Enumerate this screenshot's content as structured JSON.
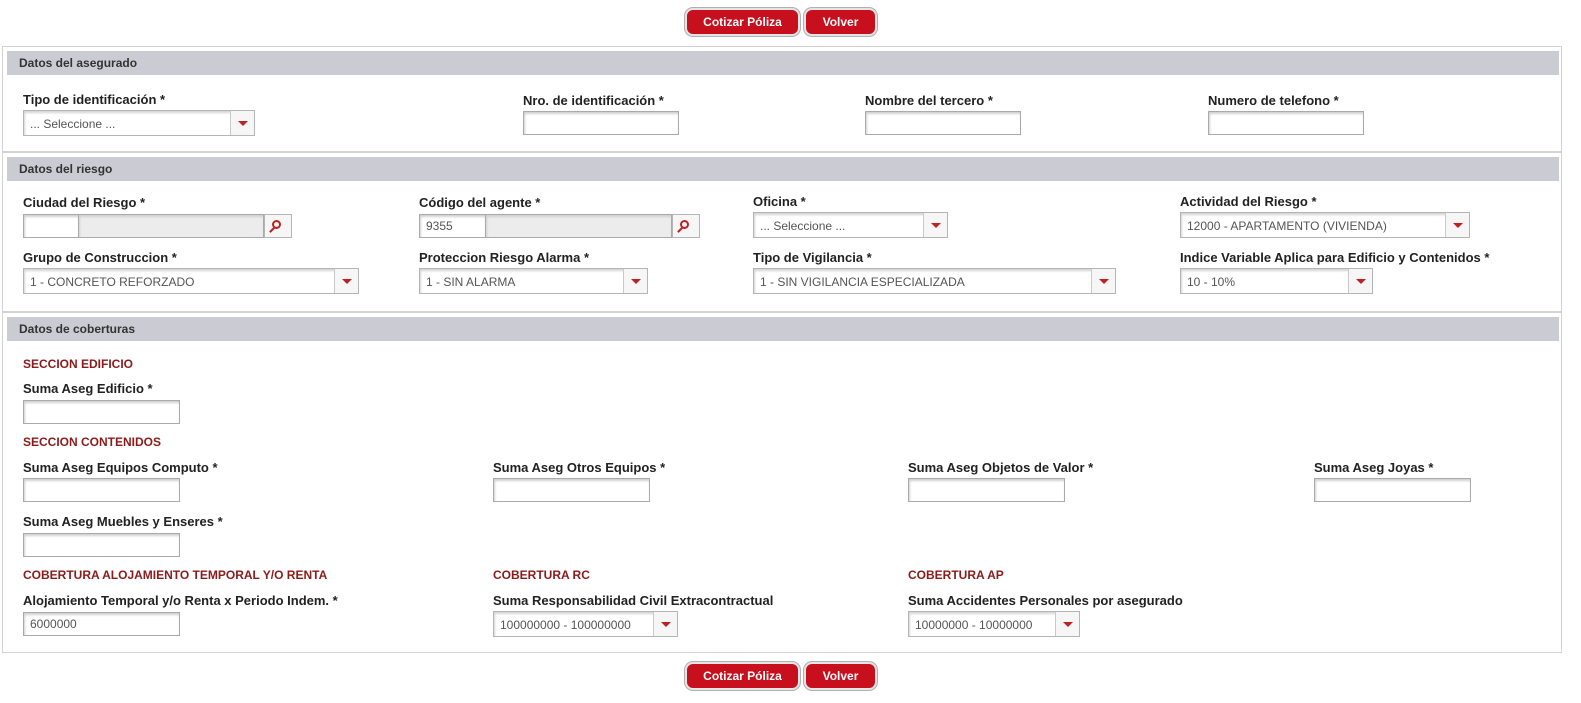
{
  "buttons": {
    "cotizar": "Cotizar Póliza",
    "volver": "Volver"
  },
  "asegurado": {
    "title": "Datos del asegurado",
    "tipo_id_label": "Tipo de identificación *",
    "tipo_id_value": "... Seleccione ...",
    "nro_id_label": "Nro. de identificación *",
    "nro_id_value": "",
    "nombre_label": "Nombre del tercero *",
    "nombre_value": "",
    "telefono_label": "Numero de telefono *",
    "telefono_value": ""
  },
  "riesgo": {
    "title": "Datos del riesgo",
    "ciudad_label": "Ciudad del Riesgo *",
    "ciudad_code": "",
    "ciudad_name": "",
    "agente_label": "Código del agente *",
    "agente_code": "9355",
    "agente_name": "",
    "oficina_label": "Oficina *",
    "oficina_value": "... Seleccione ...",
    "actividad_label": "Actividad del Riesgo *",
    "actividad_value": "12000 - APARTAMENTO (VIVIENDA)",
    "grupo_label": "Grupo de Construccion *",
    "grupo_value": "1 - CONCRETO REFORZADO",
    "alarma_label": "Proteccion Riesgo Alarma *",
    "alarma_value": "1 - SIN ALARMA",
    "vigilancia_label": "Tipo de Vigilancia *",
    "vigilancia_value": "1 - SIN VIGILANCIA ESPECIALIZADA",
    "indice_label": "Indice Variable Aplica para Edificio y Contenidos *",
    "indice_value": "10 - 10%"
  },
  "coberturas": {
    "title": "Datos de coberturas",
    "sec_edificio": "SECCION EDIFICIO",
    "edificio_label": "Suma Aseg Edificio *",
    "edificio_value": "",
    "sec_contenidos": "SECCION CONTENIDOS",
    "computo_label": "Suma Aseg Equipos Computo *",
    "computo_value": "",
    "otros_label": "Suma Aseg Otros Equipos *",
    "otros_value": "",
    "objetos_label": "Suma Aseg Objetos de Valor *",
    "objetos_value": "",
    "joyas_label": "Suma Aseg Joyas *",
    "joyas_value": "",
    "muebles_label": "Suma Aseg Muebles y Enseres *",
    "muebles_value": "",
    "sec_alojamiento": "COBERTURA ALOJAMIENTO TEMPORAL Y/O RENTA",
    "alojamiento_label": "Alojamiento Temporal y/o Renta x Periodo Indem. *",
    "alojamiento_value": "6000000",
    "sec_rc": "COBERTURA RC",
    "rc_label": "Suma Responsabilidad Civil Extracontractual",
    "rc_value": "100000000 - 100000000",
    "sec_ap": "COBERTURA AP",
    "ap_label": "Suma Accidentes Personales por asegurado",
    "ap_value": "10000000 - 10000000"
  }
}
